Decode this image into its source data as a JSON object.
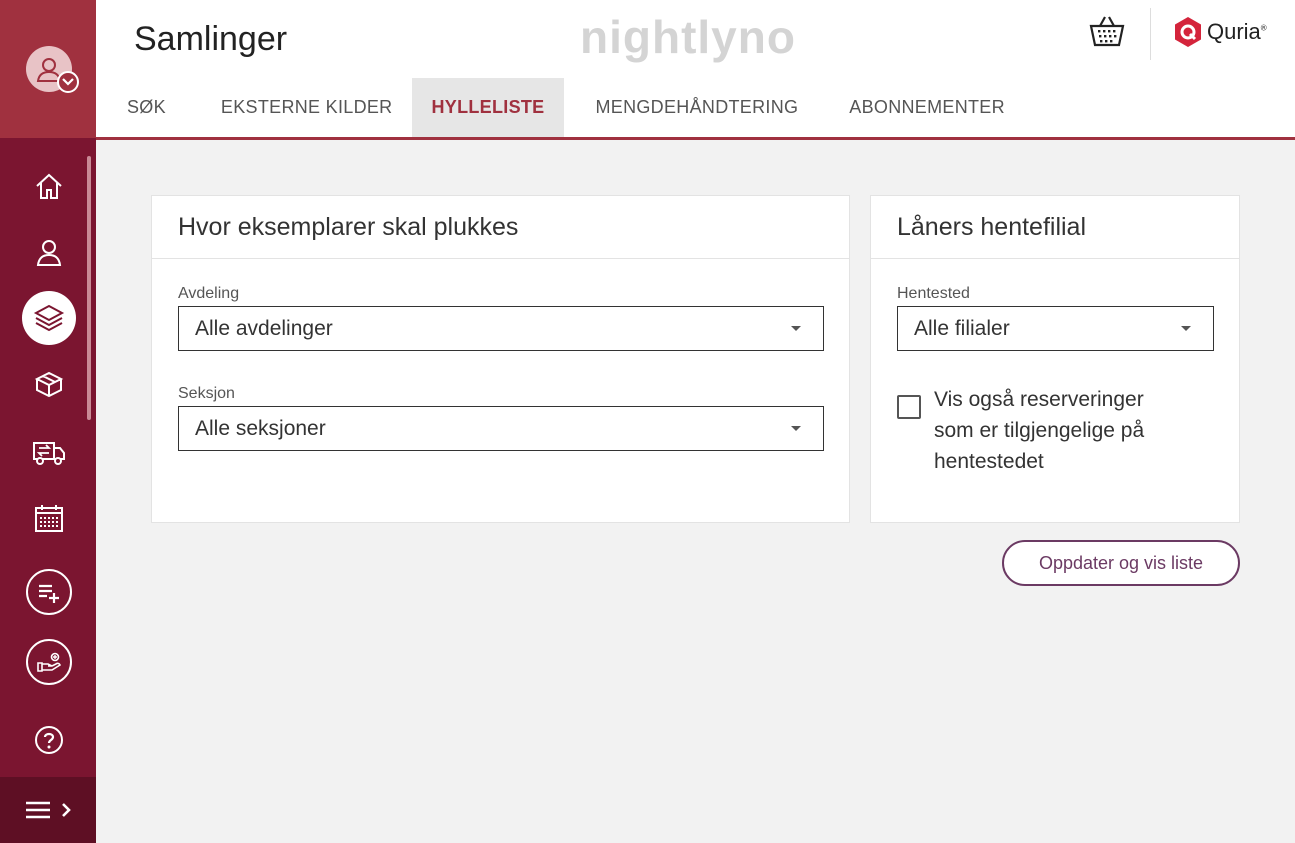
{
  "header": {
    "title": "Samlinger",
    "watermark": "nightlyno",
    "brand": "Quria"
  },
  "tabs": [
    {
      "label": "SØK",
      "active": false
    },
    {
      "label": "EKSTERNE KILDER",
      "active": false
    },
    {
      "label": "HYLLELISTE",
      "active": true
    },
    {
      "label": "MENGDEHÅNDTERING",
      "active": false
    },
    {
      "label": "ABONNEMENTER",
      "active": false
    }
  ],
  "sidebar": {
    "icons": [
      "home-icon",
      "user-icon",
      "layers-icon",
      "box-icon",
      "transfer-truck-icon",
      "calendar-icon",
      "add-list-icon",
      "hand-give-icon",
      "help-icon"
    ],
    "active": "layers-icon"
  },
  "pick_card": {
    "title": "Hvor eksemplarer skal plukkes",
    "department_label": "Avdeling",
    "department_value": "Alle avdelinger",
    "section_label": "Seksjon",
    "section_value": "Alle seksjoner"
  },
  "branch_card": {
    "title": "Låners hentefilial",
    "pickup_label": "Hentested",
    "pickup_value": "Alle filialer",
    "checkbox_line1": "Vis også reserveringer",
    "checkbox_line2": "som er tilgjengelige på",
    "checkbox_line3": "hentestedet",
    "checked": false
  },
  "actions": {
    "update_label": "Oppdater og vis liste"
  },
  "colors": {
    "sidebar": "#7b1530",
    "sidebar_top": "#a0313f",
    "accent": "#a0313f",
    "button": "#6b3a63"
  }
}
